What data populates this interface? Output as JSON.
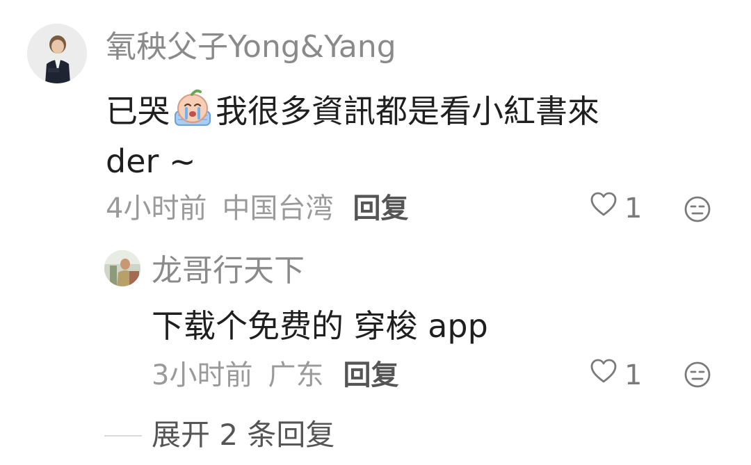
{
  "comment": {
    "username": "氧秧父子Yong&Yang",
    "text_before_emoji": "已哭",
    "emoji": "crying-face-emoji",
    "text_after_emoji": "我很多資訊都是看小紅書來",
    "text_line2": "der ~",
    "time": "4小时前",
    "location": "中国台湾",
    "reply_label": "回复",
    "like_count": "1",
    "like_icon": "heart-outline-icon",
    "dislike_icon": "unamused-face-icon"
  },
  "reply": {
    "username": "龙哥行天下",
    "text": "下载个免费的 穿梭 app",
    "time": "3小时前",
    "location": "广东",
    "reply_label": "回复",
    "like_count": "1",
    "like_icon": "heart-outline-icon",
    "dislike_icon": "unamused-face-icon"
  },
  "expand_replies_label": "展开 2 条回复",
  "colors": {
    "text_primary": "#1f1f1f",
    "text_secondary": "#8a8a8a",
    "reply_link": "#555555"
  }
}
